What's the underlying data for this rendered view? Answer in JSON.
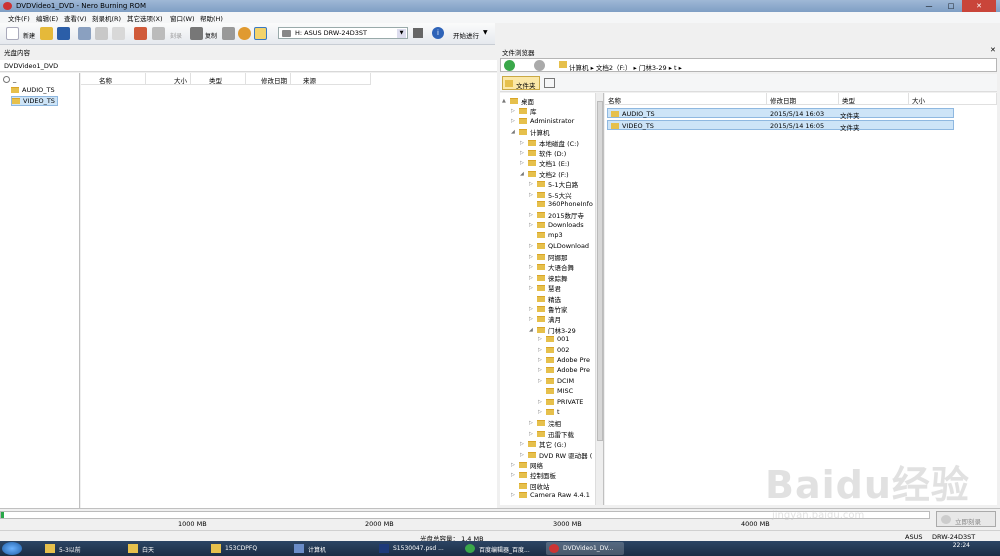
{
  "window": {
    "title": "DVDVideo1_DVD - Nero Burning ROM"
  },
  "menu": [
    "文件(F)",
    "编辑(E)",
    "查看(V)",
    "刻录机(R)",
    "其它选项(X)",
    "窗口(W)",
    "帮助(H)"
  ],
  "toolbar": {
    "new_label": "新建",
    "burn_label": "刻录",
    "copy_label": "复制",
    "drive": "H: ASUS  DRW-24D3ST",
    "start_label": "开始进行"
  },
  "left_panel": {
    "title": "光盘内容",
    "disc_name": "DVDVideo1_DVD",
    "root_label": "_",
    "tree": [
      "AUDIO_TS",
      "VIDEO_TS"
    ],
    "columns": [
      "名称",
      "大小",
      "类型",
      "修改日期",
      "来源"
    ]
  },
  "right_panel": {
    "title": "文件浏览器",
    "path": [
      "计算机",
      "文档2（F:）",
      "门林3-29",
      "t"
    ],
    "folder_button": "文件夹",
    "tree": [
      {
        "label": "桌面",
        "level": 0,
        "exp": "▲"
      },
      {
        "label": "库",
        "level": 1,
        "exp": "▷"
      },
      {
        "label": "Administrator",
        "level": 1,
        "exp": "▷"
      },
      {
        "label": "计算机",
        "level": 1,
        "exp": "◢"
      },
      {
        "label": "本地磁盘 (C:)",
        "level": 2,
        "exp": "▷"
      },
      {
        "label": "软件 (D:)",
        "level": 2,
        "exp": "▷"
      },
      {
        "label": "文档1 (E:)",
        "level": 2,
        "exp": "▷"
      },
      {
        "label": "文档2 (F:)",
        "level": 2,
        "exp": "◢"
      },
      {
        "label": "5-1大白路",
        "level": 3,
        "exp": "▷"
      },
      {
        "label": "5-5大兴",
        "level": 3,
        "exp": "▷"
      },
      {
        "label": "360PhoneInfo",
        "level": 3,
        "exp": ""
      },
      {
        "label": "2015数厅寺",
        "level": 3,
        "exp": "▷"
      },
      {
        "label": "Downloads",
        "level": 3,
        "exp": "▷"
      },
      {
        "label": "mp3",
        "level": 3,
        "exp": ""
      },
      {
        "label": "QLDownload",
        "level": 3,
        "exp": "▷"
      },
      {
        "label": "阿娜那",
        "level": 3,
        "exp": "▷"
      },
      {
        "label": "大语合舞",
        "level": 3,
        "exp": "▷"
      },
      {
        "label": "徕踪舞",
        "level": 3,
        "exp": "▷"
      },
      {
        "label": "慧君",
        "level": 3,
        "exp": "▷"
      },
      {
        "label": "精选",
        "level": 3,
        "exp": ""
      },
      {
        "label": "鲁竹家",
        "level": 3,
        "exp": "▷"
      },
      {
        "label": "满月",
        "level": 3,
        "exp": "▷"
      },
      {
        "label": "门林3-29",
        "level": 3,
        "exp": "◢"
      },
      {
        "label": "001",
        "level": 4,
        "exp": "▷"
      },
      {
        "label": "002",
        "level": 4,
        "exp": "▷"
      },
      {
        "label": "Adobe Pre",
        "level": 4,
        "exp": "▷"
      },
      {
        "label": "Adobe Pre",
        "level": 4,
        "exp": "▷"
      },
      {
        "label": "DCIM",
        "level": 4,
        "exp": "▷"
      },
      {
        "label": "MISC",
        "level": 4,
        "exp": ""
      },
      {
        "label": "PRIVATE",
        "level": 4,
        "exp": "▷"
      },
      {
        "label": "t",
        "level": 4,
        "exp": "▷"
      },
      {
        "label": "浣相",
        "level": 3,
        "exp": "▷"
      },
      {
        "label": "迅雷下载",
        "level": 3,
        "exp": "▷"
      },
      {
        "label": "其它 (G:)",
        "level": 2,
        "exp": "▷"
      },
      {
        "label": "DVD RW 驱动器 (",
        "level": 2,
        "exp": "▷"
      },
      {
        "label": "网络",
        "level": 1,
        "exp": "▷"
      },
      {
        "label": "控制面板",
        "level": 1,
        "exp": "▷"
      },
      {
        "label": "回收站",
        "level": 1,
        "exp": ""
      },
      {
        "label": "Camera Raw 4.4.1",
        "level": 1,
        "exp": "▷"
      }
    ],
    "columns": [
      "名称",
      "修改日期",
      "类型",
      "大小"
    ],
    "files": [
      {
        "name": "AUDIO_TS",
        "date": "2015/5/14 16:03",
        "type": "文件夹"
      },
      {
        "name": "VIDEO_TS",
        "date": "2015/5/14 16:05",
        "type": "文件夹"
      }
    ]
  },
  "capacity": {
    "ticks": [
      "1000 MB",
      "2000 MB",
      "3000 MB",
      "4000 MB"
    ],
    "fill_fraction": 0.003,
    "burn_button": "立即刻录"
  },
  "status": {
    "total": "光盘总容量： 1.4 MB",
    "brand": "ASUS",
    "model": "DRW-24D3ST"
  },
  "taskbar": {
    "tasks": [
      "5-3以前",
      "白天",
      "153CDPFQ",
      "计算机",
      "S1530047.psd ...",
      "百度编辑器_百度...",
      "DVDVideo1_DV..."
    ],
    "clock": "22:24"
  },
  "watermark": {
    "main": "Baidu经验",
    "sub": "jingyan.baidu.com"
  }
}
